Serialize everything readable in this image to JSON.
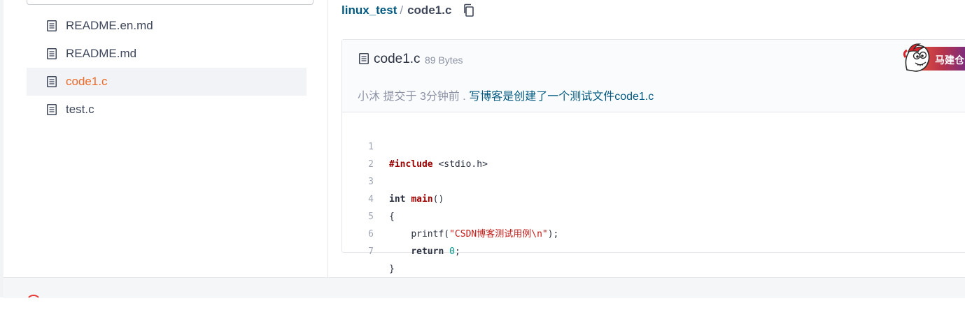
{
  "sidebar": {
    "files": [
      {
        "name": "README.en.md",
        "active": false
      },
      {
        "name": "README.md",
        "active": false
      },
      {
        "name": "code1.c",
        "active": true
      },
      {
        "name": "test.c",
        "active": false
      }
    ],
    "icon": "file-text-icon"
  },
  "breadcrumb": {
    "repo": "linux_test",
    "separator": "/",
    "file": "code1.c",
    "copy_icon": "copy-icon"
  },
  "file_header": {
    "name": "code1.c",
    "size": "89 Bytes",
    "commit_author": "小沐",
    "commit_action": "提交于",
    "commit_time": "3分钟前",
    "commit_dot": ".",
    "commit_message": "写博客是创建了一个测试文件code1.c"
  },
  "widget": {
    "label": "马建仓",
    "icon": "mascot-icon"
  },
  "code": {
    "line_numbers": [
      "1",
      "2",
      "3",
      "4",
      "5",
      "6",
      "7"
    ],
    "include_kw": "#include",
    "include_target": " <stdio.h>",
    "int_kw": "int",
    "main_fn": "main",
    "main_parens": "()",
    "open_brace": "{",
    "printf_call": "printf(",
    "printf_string": "\"CSDN博客测试用例\\n\"",
    "printf_end": ");",
    "return_kw": "return",
    "return_value": "0",
    "semicolon": ";",
    "close_brace": "}"
  },
  "colors": {
    "accent_active": "#f06a26",
    "link": "#005980",
    "keyword_red": "#990000",
    "string": "#c41a16",
    "number": "#00998a"
  }
}
